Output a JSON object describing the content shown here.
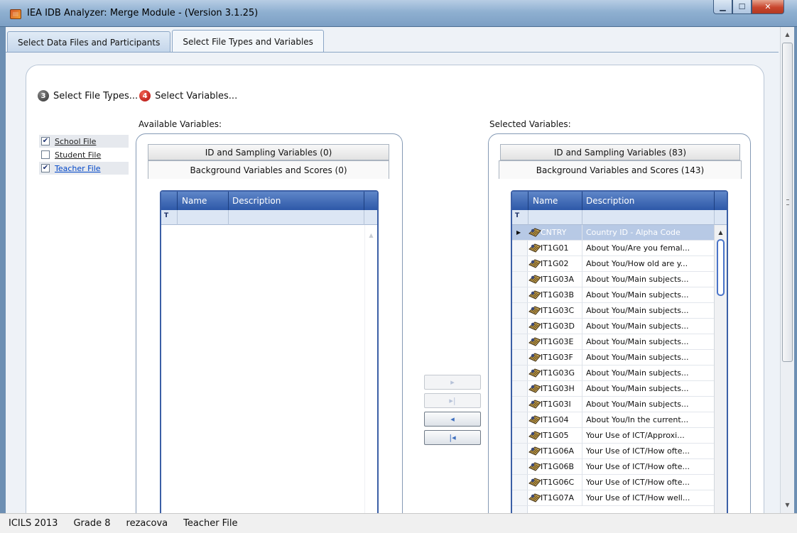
{
  "window": {
    "title": "IEA IDB Analyzer: Merge Module - (Version 3.1.25)"
  },
  "tabs": [
    {
      "label": "Select Data Files and Participants",
      "active": false
    },
    {
      "label": "Select File Types and Variables",
      "active": true
    }
  ],
  "steps": {
    "step3": {
      "number": "3",
      "label": "Select File Types..."
    },
    "step4": {
      "number": "4",
      "label": "Select Variables..."
    }
  },
  "file_types": [
    {
      "label": "School File",
      "checked": true
    },
    {
      "label": "Student File",
      "checked": false
    },
    {
      "label": "Teacher File",
      "checked": true
    }
  ],
  "available": {
    "label": "Available Variables:",
    "tab_id": "ID and Sampling Variables (0)",
    "tab_bg": "Background Variables and Scores (0)",
    "col_name": "Name",
    "col_desc": "Description"
  },
  "selected": {
    "label": "Selected Variables:",
    "tab_id": "ID and Sampling Variables (83)",
    "tab_bg": "Background Variables and Scores (143)",
    "col_name": "Name",
    "col_desc": "Description",
    "rows": [
      {
        "name": "CNTRY",
        "desc": "Country ID - Alpha Code"
      },
      {
        "name": "IT1G01",
        "desc": "About You/Are you femal..."
      },
      {
        "name": "IT1G02",
        "desc": "About You/How old are y..."
      },
      {
        "name": "IT1G03A",
        "desc": "About You/Main subjects..."
      },
      {
        "name": "IT1G03B",
        "desc": "About You/Main subjects..."
      },
      {
        "name": "IT1G03C",
        "desc": "About You/Main subjects..."
      },
      {
        "name": "IT1G03D",
        "desc": "About You/Main subjects..."
      },
      {
        "name": "IT1G03E",
        "desc": "About You/Main subjects..."
      },
      {
        "name": "IT1G03F",
        "desc": "About You/Main subjects..."
      },
      {
        "name": "IT1G03G",
        "desc": "About You/Main subjects..."
      },
      {
        "name": "IT1G03H",
        "desc": "About You/Main subjects..."
      },
      {
        "name": "IT1G03I",
        "desc": "About You/Main subjects..."
      },
      {
        "name": "IT1G04",
        "desc": "About You/In the current..."
      },
      {
        "name": "IT1G05",
        "desc": "Your Use of ICT/Approxi..."
      },
      {
        "name": "IT1G06A",
        "desc": "Your Use of ICT/How ofte..."
      },
      {
        "name": "IT1G06B",
        "desc": "Your Use of ICT/How ofte..."
      },
      {
        "name": "IT1G06C",
        "desc": "Your Use of ICT/How ofte..."
      },
      {
        "name": "IT1G07A",
        "desc": "Your Use of ICT/How well..."
      }
    ]
  },
  "move_buttons": [
    {
      "glyph": "▸",
      "name": "move-right-button",
      "enabled": false
    },
    {
      "glyph": "▸|",
      "name": "move-all-right-button",
      "enabled": false
    },
    {
      "glyph": "◂",
      "name": "move-left-button",
      "enabled": true
    },
    {
      "glyph": "|◂",
      "name": "move-all-left-button",
      "enabled": true
    }
  ],
  "status": {
    "study": "ICILS 2013",
    "grade": "Grade 8",
    "user": "rezacova",
    "file": "Teacher File"
  }
}
